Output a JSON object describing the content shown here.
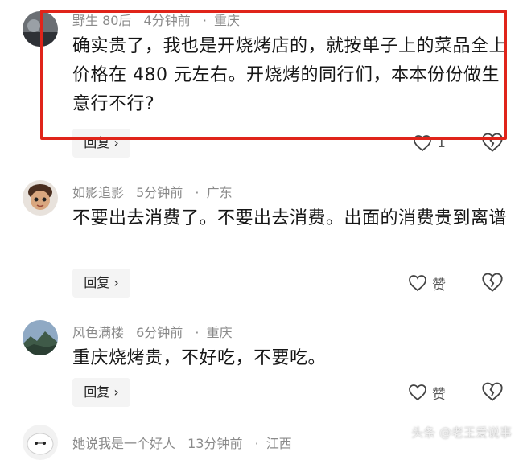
{
  "comments": [
    {
      "username": "野生 80后",
      "time": "4分钟前",
      "location": "重庆",
      "text": "确实贵了，我也是开烧烤店的，就按单子上的菜品全上价格在 480 元左右。开烧烤的同行们，本本份份做生意行不行?",
      "reply_label": "回复",
      "like_label": "1"
    },
    {
      "username": "如影追影",
      "time": "5分钟前",
      "location": "广东",
      "text": "不要出去消费了。不要出去消费。出面的消费贵到离谱",
      "reply_label": "回复",
      "like_label": "赞"
    },
    {
      "username": "风色满楼",
      "time": "6分钟前",
      "location": "重庆",
      "text": "重庆烧烤贵，不好吃，不要吃。",
      "reply_label": "回复",
      "like_label": "赞"
    },
    {
      "username": "她说我是一个好人",
      "time": "13分钟前",
      "location": "江西"
    }
  ],
  "separator": "·",
  "reply_chevron": "›",
  "watermark": "头条 @老王爱说事",
  "colors": {
    "highlight_box": "#e0241a",
    "meta_text": "#8a8a8a"
  }
}
